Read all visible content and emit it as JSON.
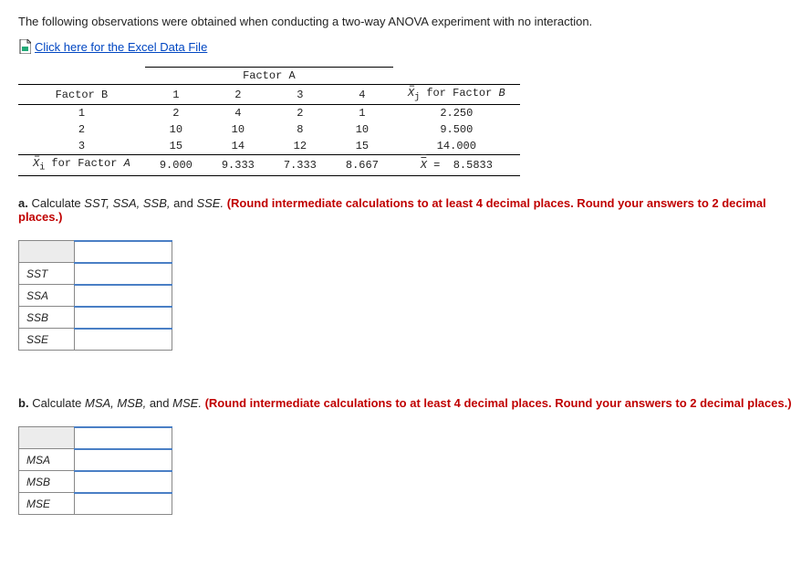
{
  "intro": "The following observations were obtained when conducting a two-way ANOVA experiment with no interaction.",
  "excel_link": "Click here for the Excel Data File",
  "chart_data": {
    "type": "table",
    "factor_a_label": "Factor A",
    "factor_b_label": "Factor B",
    "col_headers": [
      "1",
      "2",
      "3",
      "4"
    ],
    "row_mean_header": "X̄j for Factor B",
    "rows": [
      {
        "label": "1",
        "cells": [
          "2",
          "4",
          "2",
          "1"
        ],
        "mean": "2.250"
      },
      {
        "label": "2",
        "cells": [
          "10",
          "10",
          "8",
          "10"
        ],
        "mean": "9.500"
      },
      {
        "label": "3",
        "cells": [
          "15",
          "14",
          "12",
          "15"
        ],
        "mean": "14.000"
      }
    ],
    "col_mean_label": "X̄i for Factor A",
    "col_means": [
      "9.000",
      "9.333",
      "7.333",
      "8.667"
    ],
    "grand_mean_label": "X̄̄ =",
    "grand_mean": "8.5833"
  },
  "question_a": {
    "prefix": "a.",
    "text": "Calculate",
    "terms": "SST, SSA, SSB,",
    "and": "and",
    "last": "SSE.",
    "instr": "(Round intermediate calculations to at least 4 decimal places. Round your answers to 2 decimal places.)",
    "rows": [
      "SST",
      "SSA",
      "SSB",
      "SSE"
    ]
  },
  "question_b": {
    "prefix": "b.",
    "text": "Calculate",
    "terms": "MSA, MSB,",
    "and": "and",
    "last": "MSE.",
    "instr": "(Round intermediate calculations to at least 4 decimal places. Round your answers to 2 decimal places.)",
    "rows": [
      "MSA",
      "MSB",
      "MSE"
    ]
  }
}
